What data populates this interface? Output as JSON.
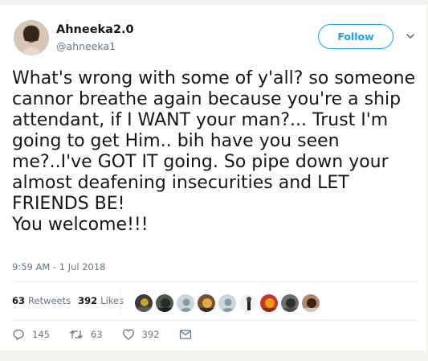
{
  "tweet": {
    "author_name": "Ahneeka2.0",
    "author_handle": "@ahneeka1",
    "follow_label": "Follow",
    "text_lines": [
      "What's wrong with some of y'all? so someone",
      "cannor breathe again because you're a ship",
      "attendant, if I WANT your man?... Trust I'm",
      "going to get Him.. bih have you seen",
      "me?..I've GOT IT going. So pipe down your",
      "almost deafening insecurities and LET",
      "FRIENDS BE!",
      "You welcome!!!"
    ],
    "timestamp": "9:59 AM - 1 Jul 2018"
  },
  "stats": {
    "retweets_count": "63",
    "retweets_label": "Retweets",
    "likes_count": "392",
    "likes_label": "Likes"
  },
  "likers": [
    "avatar",
    "avatar",
    "avatar",
    "avatar",
    "avatar",
    "avatar",
    "avatar",
    "avatar",
    "avatar"
  ],
  "actions": {
    "reply_count": "145",
    "retweet_count": "63",
    "like_count": "392"
  },
  "icons": {
    "follow": "follow-button",
    "caret": "chevron-down-icon",
    "reply": "reply-icon",
    "retweet": "retweet-icon",
    "like": "heart-icon",
    "message": "envelope-icon"
  },
  "colors": {
    "accent": "#1da1f2",
    "secondary_text": "#657786",
    "primary_text": "#14171a",
    "divider": "#e6ecf0",
    "page_bg": "#f3f2ec"
  }
}
